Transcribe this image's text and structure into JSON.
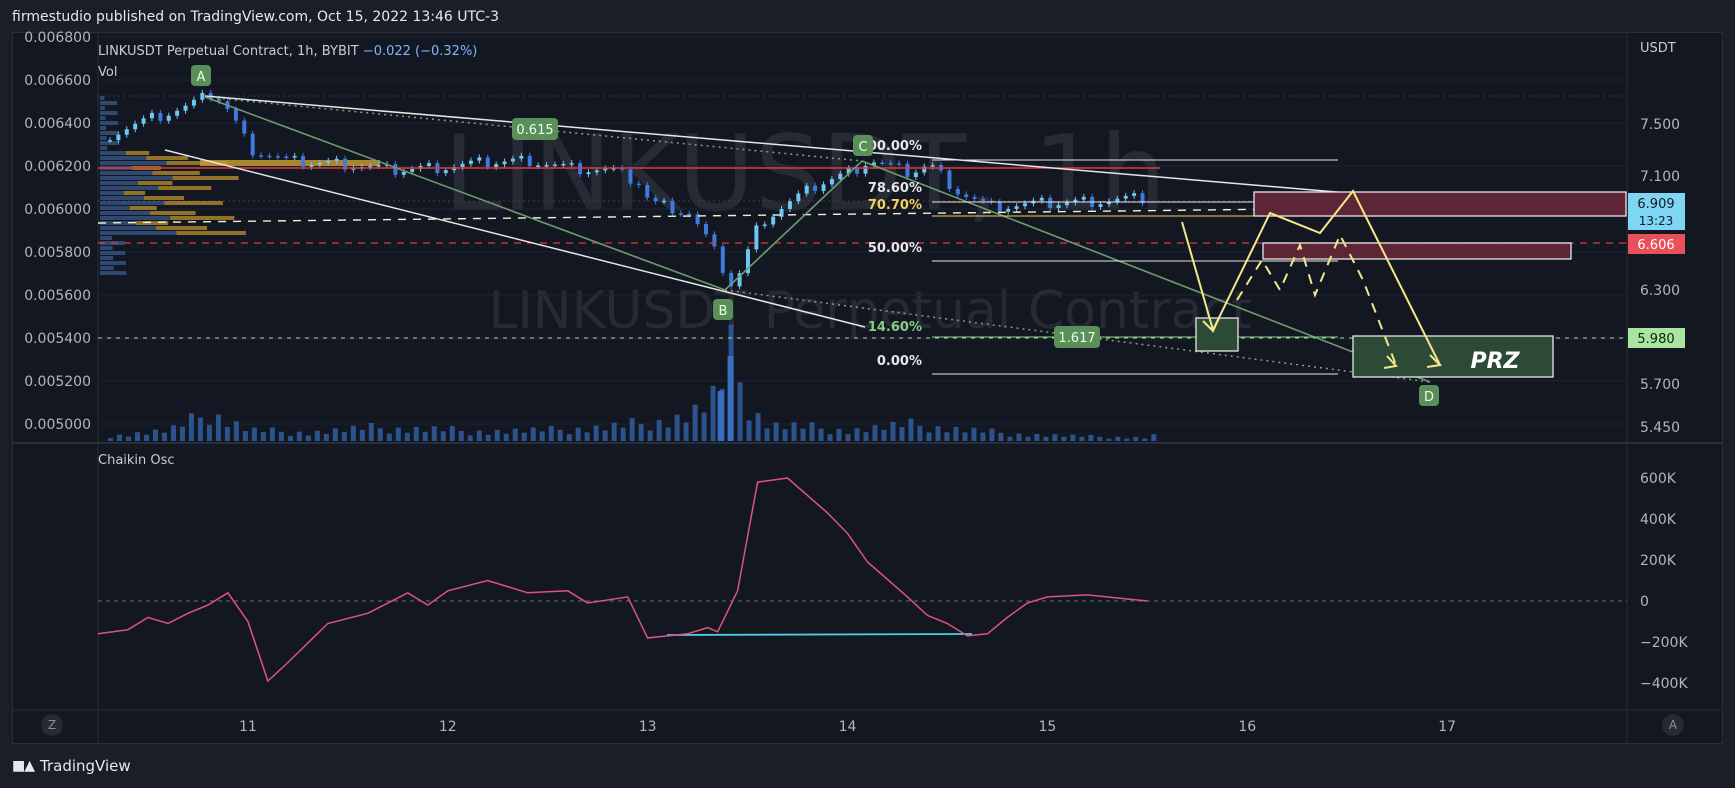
{
  "header": {
    "publisher_line": "firmestudio published on TradingView.com, Oct 15, 2022 13:46 UTC-3"
  },
  "footer": {
    "brand": "TradingView",
    "logo": "tv-logo-icon"
  },
  "legend": {
    "symbol": "LINKUSDT Perpetual Contract, 1h, BYBIT",
    "change": "−0.022 (−0.32%)",
    "vol_label": "Vol",
    "osc_label": "Chaikin Osc"
  },
  "watermark": {
    "line1": "LINKUSDT, 1h",
    "line2": "LINKUSDT Perpetual Contract"
  },
  "axes": {
    "currency": "USDT",
    "left_ticks": [
      "0.006800",
      "0.006600",
      "0.006400",
      "0.006200",
      "0.006000",
      "0.005800",
      "0.005600",
      "0.005400",
      "0.005200",
      "0.005000"
    ],
    "right_ticks": [
      "7.500",
      "7.100",
      "6.300",
      "5.700",
      "5.450"
    ],
    "osc_ticks": [
      "600K",
      "400K",
      "200K",
      "0",
      "−200K",
      "−400K"
    ],
    "x_ticks": [
      "11",
      "12",
      "13",
      "14",
      "15",
      "16",
      "17"
    ]
  },
  "price_badges": {
    "current": "6.909",
    "countdown": "13:23",
    "red_level": "6.606",
    "green_level": "5.980"
  },
  "corner_buttons": {
    "left": "Z",
    "right": "A"
  },
  "pattern": {
    "points": [
      "A",
      "B",
      "C",
      "D"
    ],
    "ratios": [
      "0.615",
      "1.617"
    ],
    "prz_label": "PRZ"
  },
  "fib_levels": [
    "100.00%",
    "78.60%",
    "70.70%",
    "50.00%",
    "14.60%",
    "0.00%"
  ],
  "colors": {
    "bull": "#6ec6f3",
    "bear": "#3d7be0",
    "pattern_green": "#6e9c6c",
    "projection_yellow": "#f4e78a",
    "osc_line": "#e0508c",
    "red_line": "#e03a3a",
    "zone_red": "#5d2535",
    "zone_green": "#2d4a36"
  },
  "chart_data": [
    {
      "type": "line",
      "title": "LINKUSDT Perpetual Contract, 1h, BYBIT",
      "x_unit": "day of October 2022",
      "xlim": [
        10.25,
        17.9
      ],
      "ylim": [
        0.00495,
        0.0068
      ],
      "series": [
        {
          "x": [
            10.3,
            10.5,
            10.7,
            10.82,
            10.9,
            11.0,
            11.2,
            11.5,
            11.7,
            12.0,
            12.2,
            12.4,
            12.6,
            12.8,
            12.95,
            13.0,
            13.1,
            13.2,
            13.3,
            13.42,
            13.55,
            13.7,
            13.85,
            14.0,
            14.1,
            14.3,
            14.4,
            14.55,
            14.7,
            14.9,
            15.1,
            15.3,
            15.5
          ],
          "y": [
            0.00635,
            0.00642,
            0.00648,
            0.00654,
            0.00645,
            0.00628,
            0.00622,
            0.00621,
            0.00618,
            0.0062,
            0.00622,
            0.00623,
            0.00619,
            0.00618,
            0.00612,
            0.00603,
            0.00601,
            0.00598,
            0.00584,
            0.00563,
            0.00594,
            0.00603,
            0.00612,
            0.00617,
            0.00623,
            0.00617,
            0.00621,
            0.00608,
            0.00601,
            0.00602,
            0.00603,
            0.00604,
            0.00605
          ]
        }
      ]
    },
    {
      "type": "bar",
      "title": "Vol",
      "x": [
        10.3,
        10.6,
        10.8,
        11.0,
        11.3,
        11.6,
        11.9,
        12.2,
        12.5,
        12.8,
        13.0,
        13.1,
        13.2,
        13.3,
        13.35,
        13.4,
        13.5,
        13.6,
        13.8,
        14.0,
        14.3,
        14.6,
        14.9,
        15.2,
        15.5
      ],
      "values": [
        0.5,
        1.0,
        2.6,
        1.0,
        0.8,
        1.2,
        1.1,
        0.9,
        1.0,
        1.3,
        1.8,
        2.0,
        2.5,
        3.6,
        4.7,
        8.0,
        3.0,
        1.5,
        1.3,
        1.0,
        1.5,
        1.0,
        0.6,
        0.4,
        0.3
      ]
    },
    {
      "type": "line",
      "title": "Chaikin Osc",
      "ylim": [
        -480000,
        700000
      ],
      "series": [
        {
          "x": [
            10.25,
            10.4,
            10.5,
            10.6,
            10.7,
            10.8,
            10.9,
            11.0,
            11.1,
            11.2,
            11.4,
            11.6,
            11.8,
            11.9,
            12.0,
            12.2,
            12.4,
            12.6,
            12.7,
            12.9,
            13.0,
            13.1,
            13.2,
            13.3,
            13.35,
            13.45,
            13.55,
            13.7,
            13.9,
            14.0,
            14.1,
            14.3,
            14.4,
            14.5,
            14.6,
            14.7,
            14.8,
            14.9,
            15.0,
            15.2,
            15.4,
            15.5
          ],
          "y": [
            -160000,
            -140000,
            -80000,
            -110000,
            -60000,
            -20000,
            40000,
            -100000,
            -390000,
            -300000,
            -110000,
            -60000,
            40000,
            -20000,
            50000,
            100000,
            40000,
            50000,
            -10000,
            20000,
            -180000,
            -170000,
            -160000,
            -130000,
            -150000,
            50000,
            580000,
            600000,
            430000,
            330000,
            190000,
            20000,
            -70000,
            -110000,
            -170000,
            -160000,
            -80000,
            -10000,
            20000,
            30000,
            10000,
            0
          ]
        }
      ]
    }
  ]
}
